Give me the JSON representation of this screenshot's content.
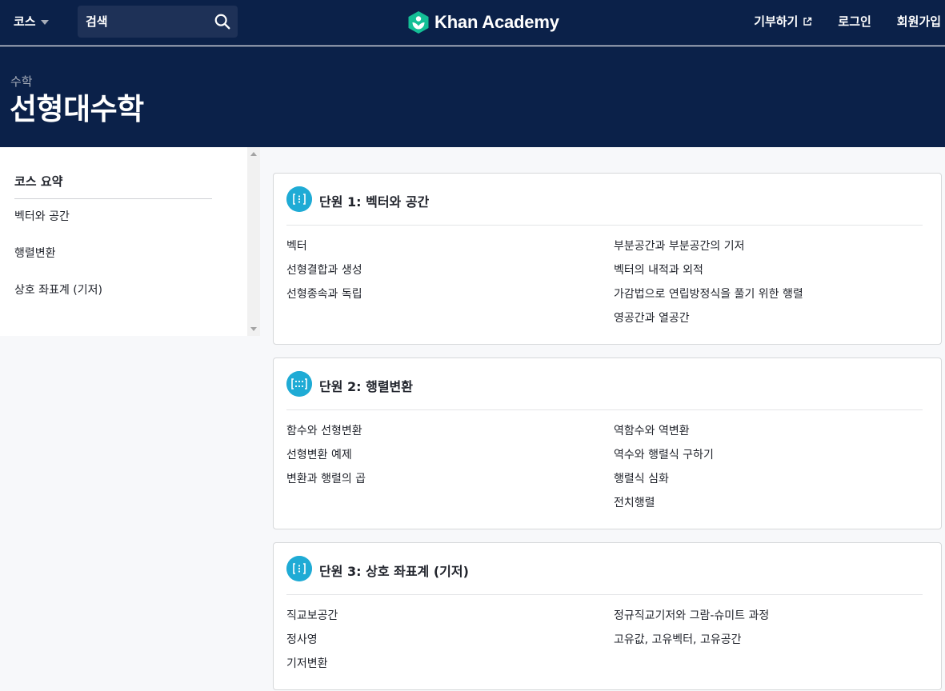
{
  "nav": {
    "courses_label": "코스",
    "search_placeholder": "검색",
    "logo_text": "Khan Academy",
    "donate_label": "기부하기",
    "login_label": "로그인",
    "signup_label": "회원가입"
  },
  "hero": {
    "breadcrumb": "수학",
    "title": "선형대수학"
  },
  "sidebar": {
    "heading": "코스 요약",
    "items": [
      "벡터와 공간",
      "행렬변환",
      "상호 좌표계 (기저)"
    ]
  },
  "units": [
    {
      "title": "단원 1: 벡터와 공간",
      "left": [
        "벡터",
        "선형결합과 생성",
        "선형종속과 독립"
      ],
      "right": [
        "부분공간과 부분공간의 기저",
        "벡터의 내적과 외적",
        "가감법으로 연립방정식을 풀기 위한 행렬",
        "영공간과 열공간"
      ]
    },
    {
      "title": "단원 2: 행렬변환",
      "left": [
        "함수와 선형변환",
        "선형변환 예제",
        "변환과 행렬의 곱"
      ],
      "right": [
        "역함수와 역변환",
        "역수와 행렬식 구하기",
        "행렬식 심화",
        "전치행렬"
      ]
    },
    {
      "title": "단원 3: 상호 좌표계 (기저)",
      "left": [
        "직교보공간",
        "정사영",
        "기저변환"
      ],
      "right": [
        "정규직교기저와 그람-슈미트 과정",
        "고유값, 고유벡터, 고유공간"
      ]
    }
  ],
  "colors": {
    "header_bg": "#0b2149",
    "logo_green": "#14bf96",
    "unit_icon": "#1fabd5"
  }
}
